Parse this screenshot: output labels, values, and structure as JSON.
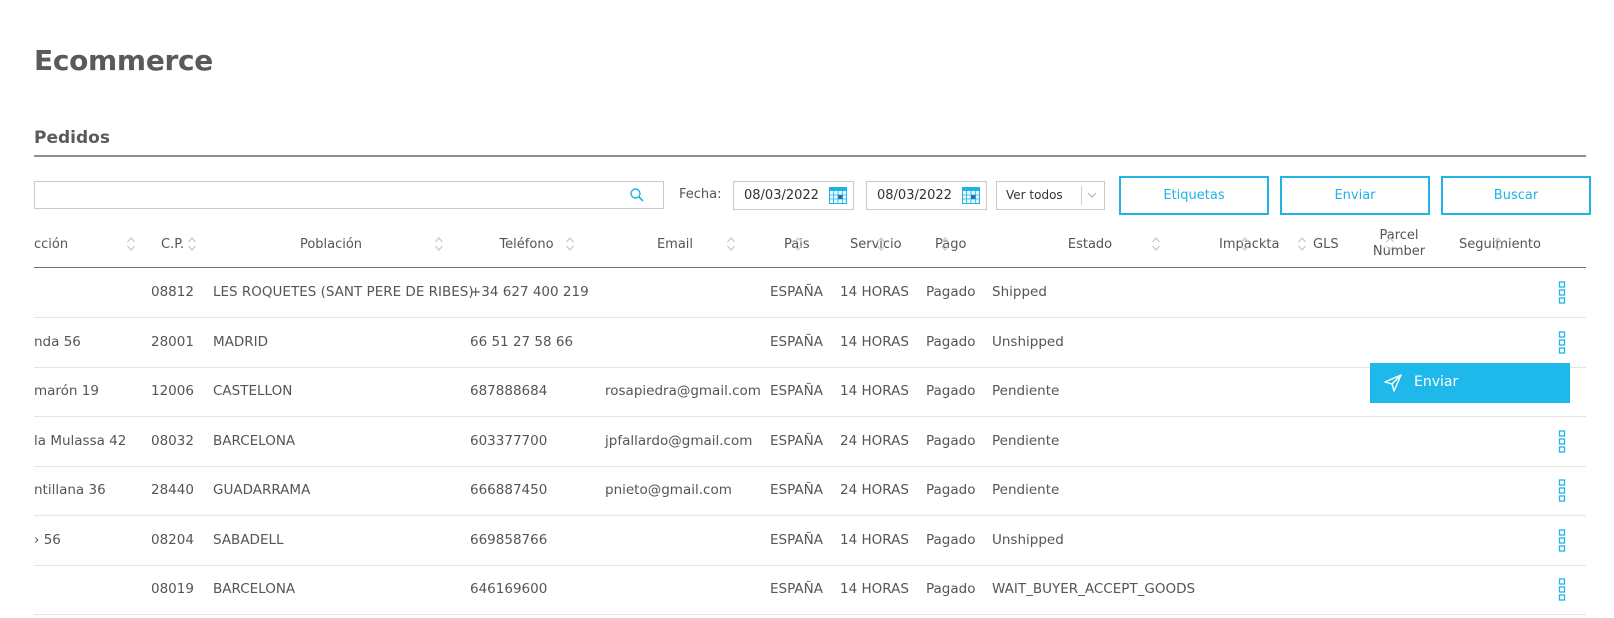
{
  "page": {
    "title": "Ecommerce",
    "section": "Pedidos"
  },
  "toolbar": {
    "search_value": "",
    "fecha_label": "Fecha:",
    "date_from": "08/03/2022",
    "date_to": "08/03/2022",
    "filter_value": "Ver todos",
    "buttons": {
      "etiquetas": "Etiquetas",
      "enviar": "Enviar",
      "buscar": "Buscar"
    }
  },
  "table": {
    "columns": [
      "cción",
      "C.P.",
      "Población",
      "Teléfono",
      "Email",
      "Pais",
      "Servicio",
      "Pago",
      "Estado",
      "Impackta",
      "GLS",
      "Parcel",
      "Number",
      "Seguimiento"
    ],
    "rows": [
      {
        "direccion": "",
        "cp": "08812",
        "poblacion": "LES ROQUETES (SANT PERE DE RIBES)",
        "telefono": "+34 627 400 219",
        "email": "",
        "pais": "ESPAÑA",
        "servicio": "14 HORAS",
        "pago": "Pagado",
        "estado": "Shipped"
      },
      {
        "direccion": "nda 56",
        "cp": "28001",
        "poblacion": "MADRID",
        "telefono": "66 51 27 58 66",
        "email": "",
        "pais": "ESPAÑA",
        "servicio": "14 HORAS",
        "pago": "Pagado",
        "estado": "Unshipped"
      },
      {
        "direccion": "marón 19",
        "cp": "12006",
        "poblacion": "CASTELLON",
        "telefono": "687888684",
        "email": "rosapiedra@gmail.com",
        "pais": "ESPAÑA",
        "servicio": "14 HORAS",
        "pago": "Pagado",
        "estado": "Pendiente"
      },
      {
        "direccion": "la Mulassa 42",
        "cp": "08032",
        "poblacion": "BARCELONA",
        "telefono": "603377700",
        "email": "jpfallardo@gmail.com",
        "pais": "ESPAÑA",
        "servicio": "24 HORAS",
        "pago": "Pagado",
        "estado": "Pendiente"
      },
      {
        "direccion": "ntillana 36",
        "cp": "28440",
        "poblacion": "GUADARRAMA",
        "telefono": "666887450",
        "email": "pnieto@gmail.com",
        "pais": "ESPAÑA",
        "servicio": "24 HORAS",
        "pago": "Pagado",
        "estado": "Pendiente"
      },
      {
        "direccion": "› 56",
        "cp": "08204",
        "poblacion": "SABADELL",
        "telefono": "669858766",
        "email": "",
        "pais": "ESPAÑA",
        "servicio": "14 HORAS",
        "pago": "Pagado",
        "estado": "Unshipped"
      },
      {
        "direccion": "",
        "cp": "08019",
        "poblacion": "BARCELONA",
        "telefono": "646169600",
        "email": "",
        "pais": "ESPAÑA",
        "servicio": "14 HORAS",
        "pago": "Pagado",
        "estado": "WAIT_BUYER_ACCEPT_GOODS"
      }
    ]
  },
  "popup": {
    "label": "Enviar",
    "icon": "send-icon"
  },
  "icons": {
    "search": "search-icon",
    "calendar": "calendar-icon",
    "dropdown": "chevron-down-icon",
    "sort": "sort-icon",
    "row_menu": "kebab-menu-icon"
  },
  "colors": {
    "accent": "#1fb3e6",
    "popup_bg": "#1fb8ea",
    "text": "#555555",
    "title": "#5a5a5a"
  }
}
